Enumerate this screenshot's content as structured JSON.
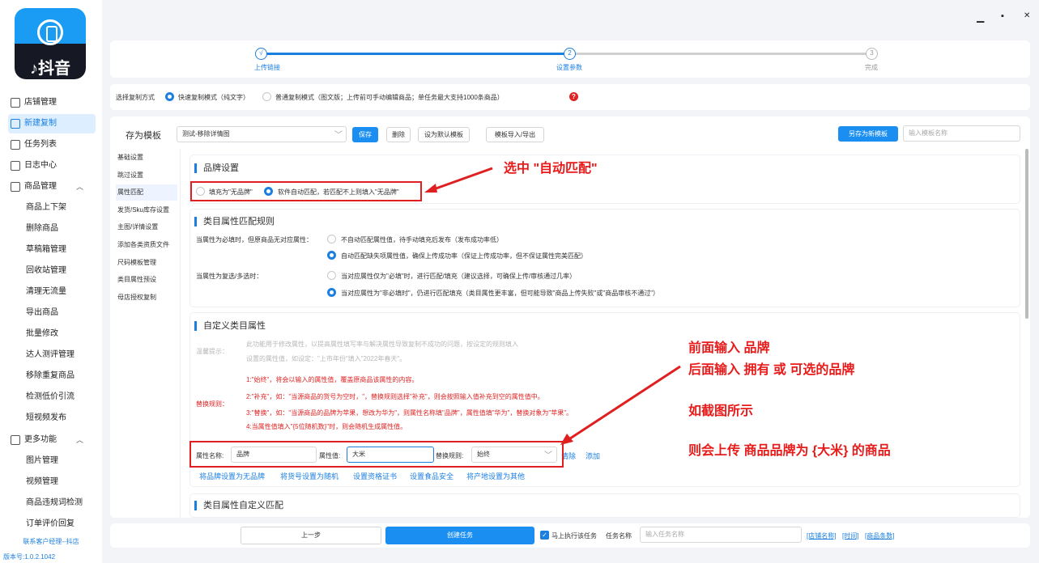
{
  "app": {
    "logo_text": "♪抖音",
    "contact": "联系客户经理--抖店",
    "version": "版本号:1.0.2.1042"
  },
  "sidebar": {
    "items": [
      {
        "label": "店铺管理",
        "icon": "store-icon",
        "level": 1,
        "active": false
      },
      {
        "label": "新建复制",
        "icon": "new-copy-icon",
        "level": 1,
        "active": true
      },
      {
        "label": "任务列表",
        "icon": "task-list-icon",
        "level": 1,
        "active": false
      },
      {
        "label": "日志中心",
        "icon": "log-icon",
        "level": 1,
        "active": false
      },
      {
        "label": "商品管理",
        "icon": "cube-icon",
        "level": 1,
        "active": false,
        "chev": "︿"
      },
      {
        "label": "商品上下架",
        "level": 2
      },
      {
        "label": "删除商品",
        "level": 2
      },
      {
        "label": "草稿箱管理",
        "level": 2
      },
      {
        "label": "回收站管理",
        "level": 2
      },
      {
        "label": "清理无流量",
        "level": 2
      },
      {
        "label": "导出商品",
        "level": 2
      },
      {
        "label": "批量修改",
        "level": 2
      },
      {
        "label": "达人测评管理",
        "level": 2
      },
      {
        "label": "移除重复商品",
        "level": 2
      },
      {
        "label": "检测低价引流",
        "level": 2
      },
      {
        "label": "短视频发布",
        "level": 2
      },
      {
        "label": "更多功能",
        "icon": "grid-icon",
        "level": 1,
        "chev": "︿"
      },
      {
        "label": "图片管理",
        "level": 2
      },
      {
        "label": "视频管理",
        "level": 2
      },
      {
        "label": "商品违规词检测",
        "level": 2
      },
      {
        "label": "订单评价回复",
        "level": 2
      }
    ]
  },
  "window": {
    "minimize": "▁",
    "maximize": "▪",
    "close": "✕"
  },
  "steps": [
    {
      "label": "上传链接",
      "marker": "√",
      "state": "done"
    },
    {
      "label": "设置参数",
      "marker": "2",
      "state": "active"
    },
    {
      "label": "完成",
      "marker": "3",
      "state": "todo"
    }
  ],
  "copy_mode": {
    "label": "选择复制方式",
    "options": [
      "快速复制模式（纯文字）",
      "普通复制模式（图文版；上传前可手动编辑商品；单任务最大支持1000条商品）"
    ],
    "selected": 0,
    "help_icon": "?"
  },
  "template": {
    "label": "存为模板",
    "value": "测试-移除详情图",
    "save": "保存",
    "delete": "删除",
    "set_default": "设为默认模板",
    "import_export": "模板导入/导出",
    "save_as_new": "另存为新模板",
    "name_placeholder": "输入模板名称"
  },
  "side_menu": [
    "基础设置",
    "跳过设置",
    "属性匹配",
    "发货/Sku库存设置",
    "主图/详情设置",
    "添加各类资质文件",
    "尺码模板管理",
    "类目属性预设",
    "母店授权复制"
  ],
  "side_menu_active": 2,
  "brand": {
    "title": "品牌设置",
    "options": [
      "填充为\"无品牌\"",
      "软件自动匹配，若匹配不上则填入\"无品牌\""
    ],
    "selected": 1
  },
  "category_rules": {
    "title": "类目属性匹配规则",
    "row1_label": "当属性为必填时，但原商品无对应属性：",
    "row1_options": [
      "不自动匹配属性值，待手动填充后发布（发布成功率低）",
      "自动匹配缺失项属性值，确保上传成功率（保证上传成功率，但不保证属性完美匹配）"
    ],
    "row1_selected": 1,
    "row2_label": "当属性为复选/多选时：",
    "row2_options": [
      "当对应属性仅为\"必填\"时，进行匹配/填充（建议选择，可确保上传/审核通过几率）",
      "当对应属性为\"非必填时\"，仍进行匹配填充（类目属性更丰富，但可能导致\"商品上传失败\"或\"商品审核不通过\"）"
    ],
    "row2_selected": 1
  },
  "custom_attr": {
    "title": "自定义类目属性",
    "tip_label": "温馨提示：",
    "tip_lines": [
      "此功能用于修改属性，以提高属性填写率与解决属性导致复制不成功的问题，按设定的规则填入",
      "设置的属性值，如设定：\"上市年份\"填入\"2022年春天\"。"
    ],
    "rule_label": "替换规则：",
    "rules": [
      "1:\"始终\"，将会以输入的属性值，覆盖原商品该属性的内容。",
      "2:\"补充\"，如：\"当源商品的货号为空时，\"，替换规则选择\"补充\"，则会按照输入值补充到空的属性值中。",
      "3:\"替换\"，如：\"当源商品的品牌为苹果，想改为华为\"，则属性名称填\"品牌\"，属性值填\"华为\"，替换对象为\"苹果\"。",
      "4:当属性值填入\"{5位随机数}\"时，则会随机生成属性值。"
    ],
    "name_label": "属性名称:",
    "name_value": "品牌",
    "value_label": "属性值:",
    "value_value": "大米",
    "replace_label": "替换规则:",
    "replace_value": "始终",
    "clear": "清除",
    "add": "添加",
    "links": [
      "将品牌设置为无品牌",
      "将货号设置为随机",
      "设置资格证书",
      "设置食品安全",
      "将产地设置为其他"
    ]
  },
  "custom_match": {
    "title": "类目属性自定义匹配"
  },
  "annotations": [
    "选中 \"自动匹配\"",
    "前面输入 品牌",
    "后面输入 拥有 或 可选的品牌",
    "如截图所示",
    "则会上传  商品品牌为 {大米} 的商品"
  ],
  "bottom": {
    "prev": "上一步",
    "create": "创建任务",
    "run_now": "马上执行该任务",
    "task_name_label": "任务名称",
    "task_name_placeholder": "输入任务名称",
    "links": [
      "[店铺名称]",
      "[时间]",
      "[商品条数]"
    ]
  }
}
